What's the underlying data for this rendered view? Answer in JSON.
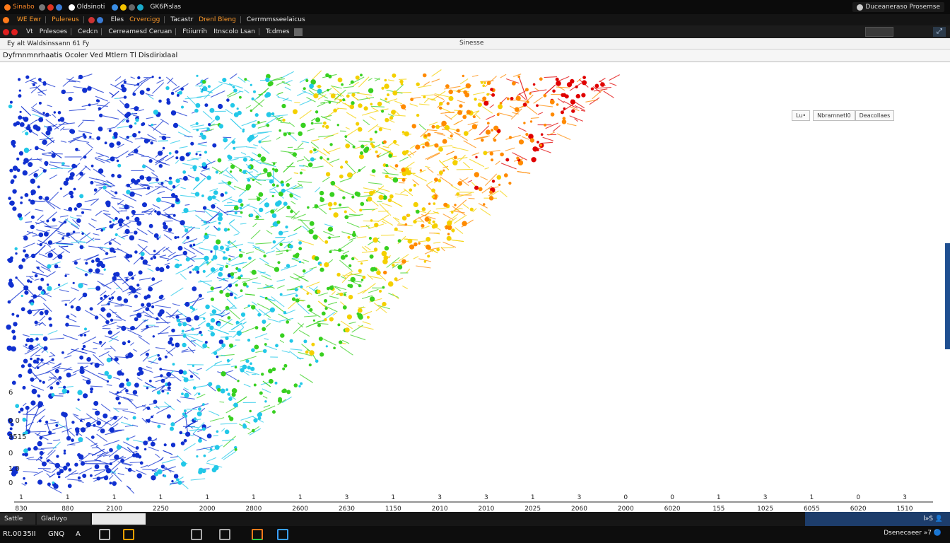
{
  "titlebar": {
    "items": [
      "Sinabo",
      "Oldsinoti",
      "GK6Pislas"
    ],
    "right_label": "Duceaneraso Prosemse"
  },
  "tabbar": {
    "tabs": [
      "WE Ewr",
      "Pulereus",
      "Eles",
      "Crvercigg",
      "Tacastr",
      "Drenl Bleng",
      "Cerrmmsseelaicus"
    ]
  },
  "menubar": {
    "items": [
      "Vt",
      "Pnlesoes",
      "Cedcn",
      "Cerreamesd Ceruan",
      "Ftiiurrih",
      "Itnscolo Lsan",
      "Tcdmes"
    ]
  },
  "addressbar": {
    "path": "Ey alt  Waldsinssann 61 Fy",
    "center_label": "Sinesse"
  },
  "document": {
    "title": "Dyfrnnmnrhaatis Ocoler  Ved Mtlern Tl Disdirixlaal"
  },
  "panel_controls": {
    "button_a": "Lu•",
    "button_b": "Nbramnetl0",
    "button_c": "Deacollaes"
  },
  "colors": {
    "blue": "#1030d0",
    "cyan": "#22c8e8",
    "green": "#38d020",
    "yellow": "#f4d000",
    "orange": "#ff8a00",
    "red": "#e00000",
    "axis": "#555555",
    "scrollbar": "#1f4f91"
  },
  "chart_data": {
    "type": "scatter",
    "xlabel": "",
    "ylabel": "",
    "title": "",
    "x_tick_top": [
      "1",
      "1",
      "1",
      "1",
      "1",
      "1",
      "1",
      "3",
      "1",
      "3",
      "3",
      "1",
      "3",
      "0",
      "0",
      "1",
      "3",
      "1",
      "0",
      "3"
    ],
    "x_tick_bottom": [
      "830",
      "880",
      "2100",
      "2250",
      "2000",
      "2800",
      "2600",
      "2630",
      "1150",
      "2010",
      "2010",
      "2025",
      "2060",
      "2000",
      "6020",
      "155",
      "1025",
      "6055",
      "6020",
      "1510"
    ],
    "y_tick_labels": [
      "6",
      "0  0",
      "3515",
      "0",
      "1  0",
      "0"
    ],
    "series_names": [],
    "color_bands": [
      "blue",
      "cyan",
      "green",
      "yellow",
      "orange",
      "red"
    ]
  },
  "taskbar": {
    "buttons": [
      "Sattle",
      "Gladvyo"
    ],
    "tray_label": "l»S  👤",
    "items": [
      "Rt.00",
      "35II",
      "GNQ",
      "A"
    ],
    "clock": "Dsenecaeer »7 🔵"
  }
}
